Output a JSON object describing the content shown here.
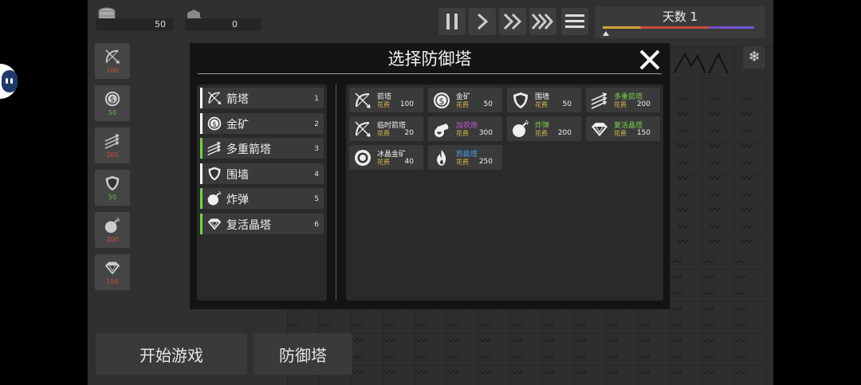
{
  "resources": {
    "coins": "50",
    "crystals": "0"
  },
  "day_label": "天数 1",
  "side_towers": [
    {
      "name": "bow",
      "cost": "100",
      "cost_color": "#d04a3a"
    },
    {
      "name": "coin",
      "cost": "50",
      "cost_color": "#5cbf4a"
    },
    {
      "name": "multi-arrow",
      "cost": "200",
      "cost_color": "#d04a3a"
    },
    {
      "name": "shield",
      "cost": "50",
      "cost_color": "#5cbf4a"
    },
    {
      "name": "bomb",
      "cost": "200",
      "cost_color": "#d04a3a"
    },
    {
      "name": "gem",
      "cost": "150",
      "cost_color": "#d04a3a"
    }
  ],
  "modal": {
    "title": "选择防御塔",
    "list": [
      {
        "label": "箭塔",
        "num": "1",
        "icon": "bow-icon"
      },
      {
        "label": "金矿",
        "num": "2",
        "icon": "coin-icon"
      },
      {
        "label": "多重箭塔",
        "num": "3",
        "icon": "multi-arrow-icon"
      },
      {
        "label": "围墙",
        "num": "4",
        "icon": "shield-icon"
      },
      {
        "label": "炸弹",
        "num": "5",
        "icon": "bomb-icon"
      },
      {
        "label": "复活晶塔",
        "num": "6",
        "icon": "gem-icon"
      }
    ],
    "cost_label": "花费",
    "towers": [
      {
        "name": "箭塔",
        "price": "100",
        "color": "#f0f0f0",
        "icon": "bow-icon"
      },
      {
        "name": "金矿",
        "price": "50",
        "color": "#f0f0f0",
        "icon": "coin-icon"
      },
      {
        "name": "围墙",
        "price": "50",
        "color": "#f0f0f0",
        "icon": "shield-icon"
      },
      {
        "name": "多重箭塔",
        "price": "200",
        "color": "#7ad04a",
        "icon": "multi-arrow-icon"
      },
      {
        "name": "临时箭塔",
        "price": "20",
        "color": "#f0f0f0",
        "icon": "bow-icon"
      },
      {
        "name": "加农炮",
        "price": "300",
        "color": "#c05ad8",
        "icon": "cannon-icon"
      },
      {
        "name": "炸弹",
        "price": "200",
        "color": "#7ad04a",
        "icon": "bomb-icon"
      },
      {
        "name": "复活晶塔",
        "price": "150",
        "color": "#7ad04a",
        "icon": "gem-icon"
      },
      {
        "name": "冰晶金矿",
        "price": "40",
        "color": "#f0f0f0",
        "icon": "ice-coin-icon"
      },
      {
        "name": "热能塔",
        "price": "250",
        "color": "#4aa0e8",
        "icon": "fire-icon"
      }
    ]
  },
  "buttons": {
    "start": "开始游戏",
    "defense": "防御塔"
  }
}
